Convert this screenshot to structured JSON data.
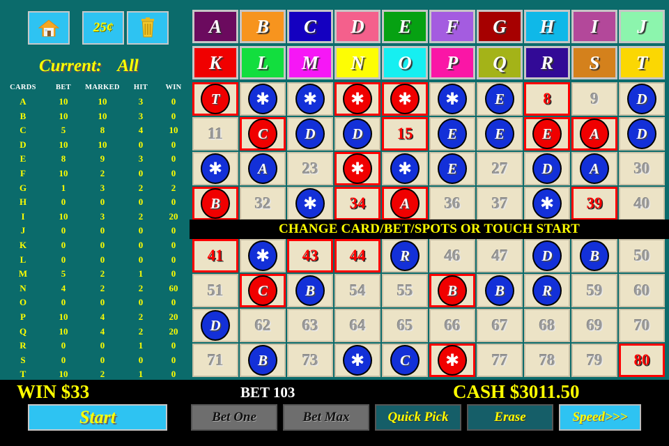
{
  "header": {
    "home_icon": "home-icon",
    "denomination": "25¢",
    "trash_icon": "trash-icon",
    "current_label": "Current:",
    "current_value": "All"
  },
  "stats": {
    "columns": [
      "CARDS",
      "BET",
      "MARKED",
      "HIT",
      "WIN"
    ],
    "rows": [
      {
        "card": "A",
        "bet": "10",
        "marked": "10",
        "hit": "3",
        "win": "0"
      },
      {
        "card": "B",
        "bet": "10",
        "marked": "10",
        "hit": "3",
        "win": "0"
      },
      {
        "card": "C",
        "bet": "5",
        "marked": "8",
        "hit": "4",
        "win": "10"
      },
      {
        "card": "D",
        "bet": "10",
        "marked": "10",
        "hit": "0",
        "win": "0"
      },
      {
        "card": "E",
        "bet": "8",
        "marked": "9",
        "hit": "3",
        "win": "0"
      },
      {
        "card": "F",
        "bet": "10",
        "marked": "2",
        "hit": "0",
        "win": "0"
      },
      {
        "card": "G",
        "bet": "1",
        "marked": "3",
        "hit": "2",
        "win": "2"
      },
      {
        "card": "H",
        "bet": "0",
        "marked": "0",
        "hit": "0",
        "win": "0"
      },
      {
        "card": "I",
        "bet": "10",
        "marked": "3",
        "hit": "2",
        "win": "20"
      },
      {
        "card": "J",
        "bet": "0",
        "marked": "0",
        "hit": "0",
        "win": "0"
      },
      {
        "card": "K",
        "bet": "0",
        "marked": "0",
        "hit": "0",
        "win": "0"
      },
      {
        "card": "L",
        "bet": "0",
        "marked": "0",
        "hit": "0",
        "win": "0"
      },
      {
        "card": "M",
        "bet": "5",
        "marked": "2",
        "hit": "1",
        "win": "0"
      },
      {
        "card": "N",
        "bet": "4",
        "marked": "2",
        "hit": "2",
        "win": "60"
      },
      {
        "card": "O",
        "bet": "0",
        "marked": "0",
        "hit": "0",
        "win": "0"
      },
      {
        "card": "P",
        "bet": "10",
        "marked": "4",
        "hit": "2",
        "win": "20"
      },
      {
        "card": "Q",
        "bet": "10",
        "marked": "4",
        "hit": "2",
        "win": "20"
      },
      {
        "card": "R",
        "bet": "0",
        "marked": "0",
        "hit": "1",
        "win": "0"
      },
      {
        "card": "S",
        "bet": "0",
        "marked": "0",
        "hit": "0",
        "win": "0"
      },
      {
        "card": "T",
        "bet": "10",
        "marked": "2",
        "hit": "1",
        "win": "0"
      }
    ]
  },
  "card_buttons": [
    {
      "label": "A",
      "color": "#6b0a5e"
    },
    {
      "label": "B",
      "color": "#f7941e"
    },
    {
      "label": "C",
      "color": "#1400c0"
    },
    {
      "label": "D",
      "color": "#f4608c"
    },
    {
      "label": "E",
      "color": "#06a112"
    },
    {
      "label": "F",
      "color": "#a45ce0"
    },
    {
      "label": "G",
      "color": "#a60000"
    },
    {
      "label": "H",
      "color": "#0fb8e8"
    },
    {
      "label": "I",
      "color": "#b3489a"
    },
    {
      "label": "J",
      "color": "#8cf5ad"
    },
    {
      "label": "K",
      "color": "#f00000"
    },
    {
      "label": "L",
      "color": "#12de3e"
    },
    {
      "label": "M",
      "color": "#f617f6"
    },
    {
      "label": "N",
      "color": "#fdfd04"
    },
    {
      "label": "O",
      "color": "#16eff1"
    },
    {
      "label": "P",
      "color": "#fa16a6"
    },
    {
      "label": "Q",
      "color": "#a4b318"
    },
    {
      "label": "R",
      "color": "#320a96"
    },
    {
      "label": "S",
      "color": "#d4811c"
    },
    {
      "label": "T",
      "color": "#fbd703"
    }
  ],
  "board": {
    "banner": "CHANGE CARD/BET/SPOTS OR TOUCH START",
    "cells": [
      {
        "n": "1",
        "state": "ball-red",
        "mark": "T",
        "hit": true
      },
      {
        "n": "2",
        "state": "ball-blue",
        "mark": "*",
        "hit": false
      },
      {
        "n": "3",
        "state": "ball-blue",
        "mark": "*",
        "hit": false
      },
      {
        "n": "4",
        "state": "ball-red",
        "mark": "*",
        "hit": true
      },
      {
        "n": "5",
        "state": "ball-red",
        "mark": "*",
        "hit": true
      },
      {
        "n": "6",
        "state": "ball-blue",
        "mark": "*",
        "hit": false
      },
      {
        "n": "7",
        "state": "ball-blue",
        "mark": "E",
        "hit": false
      },
      {
        "n": "8",
        "state": "drawn",
        "mark": "",
        "hit": true
      },
      {
        "n": "9",
        "state": "plain",
        "mark": "",
        "hit": false
      },
      {
        "n": "10",
        "state": "ball-blue",
        "mark": "D",
        "hit": false
      },
      {
        "n": "11",
        "state": "plain",
        "mark": "",
        "hit": false
      },
      {
        "n": "12",
        "state": "ball-red",
        "mark": "C",
        "hit": true
      },
      {
        "n": "13",
        "state": "ball-blue",
        "mark": "D",
        "hit": false
      },
      {
        "n": "14",
        "state": "ball-blue",
        "mark": "D",
        "hit": false
      },
      {
        "n": "15",
        "state": "drawn",
        "mark": "",
        "hit": true
      },
      {
        "n": "16",
        "state": "ball-blue",
        "mark": "E",
        "hit": false
      },
      {
        "n": "17",
        "state": "ball-blue",
        "mark": "E",
        "hit": false
      },
      {
        "n": "18",
        "state": "ball-red",
        "mark": "E",
        "hit": true
      },
      {
        "n": "19",
        "state": "ball-red",
        "mark": "A",
        "hit": true
      },
      {
        "n": "20",
        "state": "ball-blue",
        "mark": "D",
        "hit": false
      },
      {
        "n": "21",
        "state": "ball-blue",
        "mark": "*",
        "hit": false
      },
      {
        "n": "22",
        "state": "ball-blue",
        "mark": "A",
        "hit": false
      },
      {
        "n": "23",
        "state": "plain",
        "mark": "",
        "hit": false
      },
      {
        "n": "24",
        "state": "ball-red",
        "mark": "*",
        "hit": true
      },
      {
        "n": "25",
        "state": "ball-blue",
        "mark": "*",
        "hit": false
      },
      {
        "n": "26",
        "state": "ball-blue",
        "mark": "E",
        "hit": false
      },
      {
        "n": "27",
        "state": "plain",
        "mark": "",
        "hit": false
      },
      {
        "n": "28",
        "state": "ball-blue",
        "mark": "D",
        "hit": false
      },
      {
        "n": "29",
        "state": "ball-blue",
        "mark": "A",
        "hit": false
      },
      {
        "n": "30",
        "state": "plain",
        "mark": "",
        "hit": false
      },
      {
        "n": "31",
        "state": "ball-red",
        "mark": "B",
        "hit": true
      },
      {
        "n": "32",
        "state": "plain",
        "mark": "",
        "hit": false
      },
      {
        "n": "33",
        "state": "ball-blue",
        "mark": "*",
        "hit": false
      },
      {
        "n": "34",
        "state": "drawn",
        "mark": "",
        "hit": true
      },
      {
        "n": "35",
        "state": "ball-red",
        "mark": "A",
        "hit": true
      },
      {
        "n": "36",
        "state": "plain",
        "mark": "",
        "hit": false
      },
      {
        "n": "37",
        "state": "plain",
        "mark": "",
        "hit": false
      },
      {
        "n": "38",
        "state": "ball-blue",
        "mark": "*",
        "hit": false
      },
      {
        "n": "39",
        "state": "drawn",
        "mark": "",
        "hit": true
      },
      {
        "n": "40",
        "state": "plain",
        "mark": "",
        "hit": false
      },
      {
        "n": "41",
        "state": "drawn",
        "mark": "",
        "hit": true
      },
      {
        "n": "42",
        "state": "ball-blue",
        "mark": "*",
        "hit": false
      },
      {
        "n": "43",
        "state": "drawn",
        "mark": "",
        "hit": true
      },
      {
        "n": "44",
        "state": "drawn",
        "mark": "",
        "hit": true
      },
      {
        "n": "45",
        "state": "ball-blue",
        "mark": "R",
        "hit": false
      },
      {
        "n": "46",
        "state": "plain",
        "mark": "",
        "hit": false
      },
      {
        "n": "47",
        "state": "plain",
        "mark": "",
        "hit": false
      },
      {
        "n": "48",
        "state": "ball-blue",
        "mark": "D",
        "hit": false
      },
      {
        "n": "49",
        "state": "ball-blue",
        "mark": "B",
        "hit": false
      },
      {
        "n": "50",
        "state": "plain",
        "mark": "",
        "hit": false
      },
      {
        "n": "51",
        "state": "plain",
        "mark": "",
        "hit": false
      },
      {
        "n": "52",
        "state": "ball-red",
        "mark": "C",
        "hit": true
      },
      {
        "n": "53",
        "state": "ball-blue",
        "mark": "B",
        "hit": false
      },
      {
        "n": "54",
        "state": "plain",
        "mark": "",
        "hit": false
      },
      {
        "n": "55",
        "state": "plain",
        "mark": "",
        "hit": false
      },
      {
        "n": "56",
        "state": "ball-red",
        "mark": "B",
        "hit": true
      },
      {
        "n": "57",
        "state": "ball-blue",
        "mark": "B",
        "hit": false
      },
      {
        "n": "58",
        "state": "ball-blue",
        "mark": "R",
        "hit": false
      },
      {
        "n": "59",
        "state": "plain",
        "mark": "",
        "hit": false
      },
      {
        "n": "60",
        "state": "plain",
        "mark": "",
        "hit": false
      },
      {
        "n": "61",
        "state": "ball-blue",
        "mark": "D",
        "hit": false
      },
      {
        "n": "62",
        "state": "plain",
        "mark": "",
        "hit": false
      },
      {
        "n": "63",
        "state": "plain",
        "mark": "",
        "hit": false
      },
      {
        "n": "64",
        "state": "plain",
        "mark": "",
        "hit": false
      },
      {
        "n": "65",
        "state": "plain",
        "mark": "",
        "hit": false
      },
      {
        "n": "66",
        "state": "plain",
        "mark": "",
        "hit": false
      },
      {
        "n": "67",
        "state": "plain",
        "mark": "",
        "hit": false
      },
      {
        "n": "68",
        "state": "plain",
        "mark": "",
        "hit": false
      },
      {
        "n": "69",
        "state": "plain",
        "mark": "",
        "hit": false
      },
      {
        "n": "70",
        "state": "plain",
        "mark": "",
        "hit": false
      },
      {
        "n": "71",
        "state": "plain",
        "mark": "",
        "hit": false
      },
      {
        "n": "72",
        "state": "ball-blue",
        "mark": "B",
        "hit": false
      },
      {
        "n": "73",
        "state": "plain",
        "mark": "",
        "hit": false
      },
      {
        "n": "74",
        "state": "ball-blue",
        "mark": "*",
        "hit": false
      },
      {
        "n": "75",
        "state": "ball-blue",
        "mark": "C",
        "hit": false
      },
      {
        "n": "76",
        "state": "ball-red",
        "mark": "*",
        "hit": true
      },
      {
        "n": "77",
        "state": "plain",
        "mark": "",
        "hit": false
      },
      {
        "n": "78",
        "state": "plain",
        "mark": "",
        "hit": false
      },
      {
        "n": "79",
        "state": "plain",
        "mark": "",
        "hit": false
      },
      {
        "n": "80",
        "state": "drawn",
        "mark": "",
        "hit": true
      }
    ]
  },
  "status": {
    "win_label": "WIN  $33",
    "bet_label": "BET 103",
    "cash_label": "CASH  $3011.50"
  },
  "buttons": {
    "start": "Start",
    "bet_one": "Bet One",
    "bet_max": "Bet Max",
    "quick_pick": "Quick Pick",
    "erase": "Erase",
    "speed": "Speed>>>"
  },
  "colors": {
    "felt": "#0b6b6b",
    "cell_bg": "#ece3c6",
    "hit_border": "#ff0000",
    "accent_yellow": "#ffff00",
    "cyan_button": "#2ec3f2"
  }
}
